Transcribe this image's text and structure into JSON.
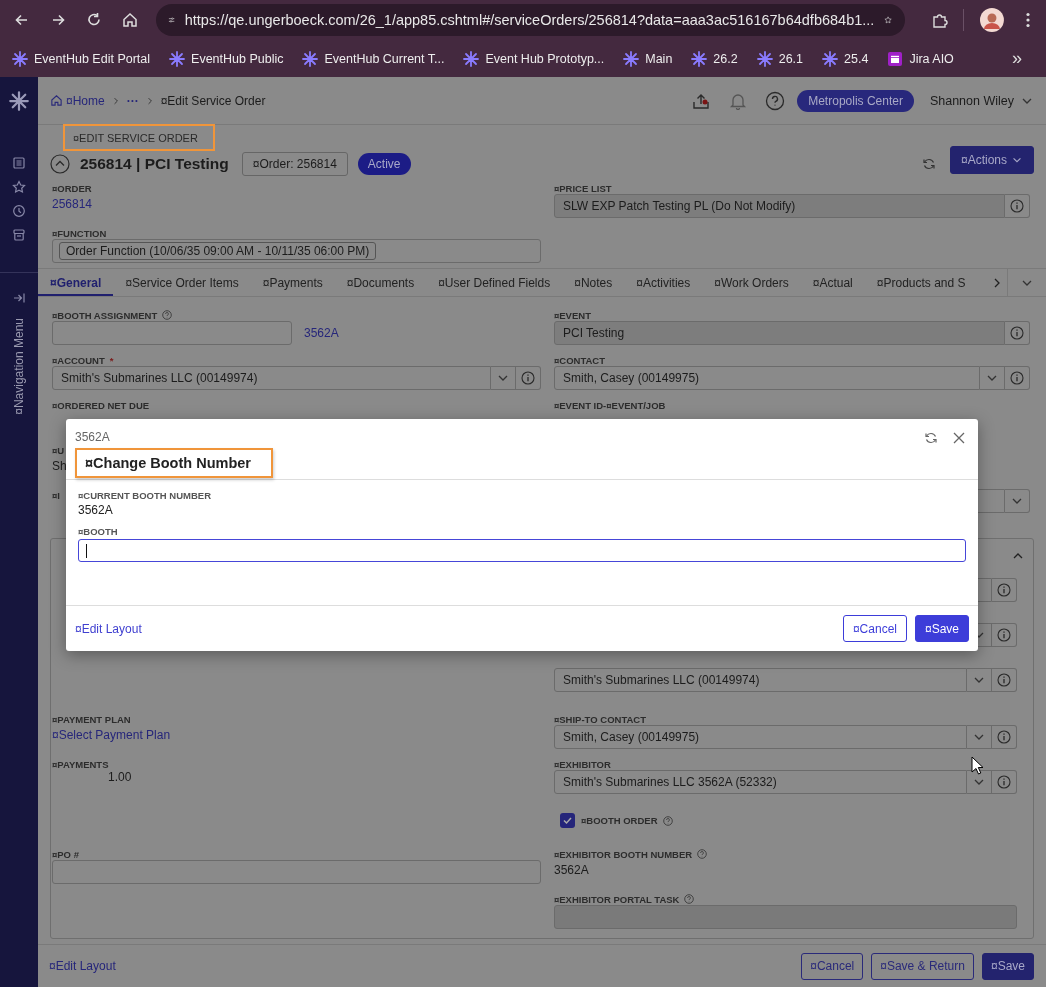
{
  "browser": {
    "url": "https://qe.ungerboeck.com/26_1/app85.cshtml#/serviceOrders/256814?data=aaa3ac516167b64dfb684b1...",
    "bookmarks": [
      {
        "label": "EventHub Edit Portal",
        "kind": "asterisk"
      },
      {
        "label": "EventHub Public",
        "kind": "asterisk"
      },
      {
        "label": "EventHub Current T...",
        "kind": "asterisk"
      },
      {
        "label": "Event Hub Prototyp...",
        "kind": "asterisk"
      },
      {
        "label": "Main",
        "kind": "asterisk"
      },
      {
        "label": "26.2",
        "kind": "asterisk"
      },
      {
        "label": "26.1",
        "kind": "asterisk"
      },
      {
        "label": "25.4",
        "kind": "asterisk"
      },
      {
        "label": "Jira AIO",
        "kind": "jira"
      }
    ],
    "overflow": "»"
  },
  "rail": {
    "nav_label": "¤Navigation Menu"
  },
  "header": {
    "breadcrumb": [
      {
        "label": "¤Home",
        "kind": "home"
      },
      {
        "label": "···",
        "kind": "ellipsis"
      },
      {
        "label": "¤Edit Service Order",
        "kind": "current"
      }
    ],
    "venue": "Metropolis Center",
    "user": "Shannon Wiley"
  },
  "page": {
    "eyebrow": "¤EDIT SERVICE ORDER",
    "title": "256814 | PCI Testing",
    "chip": "¤Order: 256814",
    "status": "Active",
    "actions": "¤Actions"
  },
  "top_rows": [
    [
      {
        "label": "¤ORDER",
        "kind": "link",
        "value": "256814"
      },
      {
        "label": "¤PRICE LIST",
        "kind": "readonly-info",
        "value": "SLW EXP Patch Testing PL (Do Not Modify)"
      }
    ],
    [
      {
        "label": "¤FUNCTION",
        "kind": "chip",
        "value": "Order Function (10/06/35 09:00 AM - 10/11/35 06:00 PM)"
      },
      null
    ]
  ],
  "tabs": [
    {
      "label": "¤General",
      "selected": true
    },
    {
      "label": "¤Service Order Items",
      "selected": false
    },
    {
      "label": "¤Payments",
      "selected": false
    },
    {
      "label": "¤Documents",
      "selected": false
    },
    {
      "label": "¤User Defined Fields",
      "selected": false
    },
    {
      "label": "¤Notes",
      "selected": false
    },
    {
      "label": "¤Activities",
      "selected": false
    },
    {
      "label": "¤Work Orders",
      "selected": false
    },
    {
      "label": "¤Actual",
      "selected": false
    },
    {
      "label": "¤Products and S",
      "selected": false
    }
  ],
  "general_rows": [
    [
      {
        "label": "¤BOOTH ASSIGNMENT",
        "help": true,
        "kind": "input-link",
        "value": "3562A"
      },
      {
        "label": "¤EVENT",
        "kind": "readonly-info",
        "value": "PCI Testing"
      }
    ],
    [
      {
        "label": "¤ACCOUNT",
        "required_mark": "*",
        "kind": "select-info",
        "value": "Smith's Submarines LLC (00149974)"
      },
      {
        "label": "¤CONTACT",
        "kind": "select-info",
        "value": "Smith, Casey (00149975)"
      }
    ],
    [
      {
        "label": "¤ORDERED NET DUE",
        "kind": "none"
      },
      {
        "label": "¤EVENT ID-¤EVENT/JOB",
        "kind": "none"
      }
    ],
    [
      {
        "label": "¤U",
        "kind": "text",
        "value": "Sh"
      },
      null
    ],
    [
      {
        "label": "¤I",
        "kind": "none"
      },
      {
        "kind": "select"
      }
    ]
  ],
  "panel_rows": [
    [
      null,
      {
        "kind": "input-info"
      }
    ],
    [
      null,
      {
        "kind": "select-info"
      }
    ],
    [
      null,
      {
        "kind": "select-info",
        "value": "Smith's Submarines LLC (00149974)"
      }
    ],
    [
      {
        "label": "¤PAYMENT PLAN",
        "kind": "link",
        "value": "¤Select Payment Plan"
      },
      {
        "label": "¤SHIP-TO CONTACT",
        "kind": "select-info",
        "value": "Smith, Casey (00149975)"
      }
    ],
    [
      {
        "label": "¤PAYMENTS",
        "kind": "amount",
        "value": "1.00"
      },
      {
        "label": "¤EXHIBITOR",
        "kind": "select-info",
        "value": "Smith's Submarines LLC 3562A (52332)"
      }
    ],
    [
      null,
      {
        "label": "¤BOOTH ORDER",
        "help": true,
        "kind": "checkbox",
        "checked": true
      }
    ],
    [
      {
        "label": "¤PO #",
        "kind": "input"
      },
      {
        "label": "¤EXHIBITOR BOOTH NUMBER",
        "help": true,
        "kind": "text",
        "value": "3562A"
      }
    ],
    [
      null,
      {
        "label": "¤EXHIBITOR PORTAL TASK",
        "help": true,
        "kind": "disabled"
      }
    ]
  ],
  "footer": {
    "link": "¤Edit Layout",
    "buttons": [
      {
        "label": "¤Cancel",
        "kind": "secondary"
      },
      {
        "label": "¤Save & Return",
        "kind": "secondary"
      },
      {
        "label": "¤Save",
        "kind": "primary"
      }
    ]
  },
  "dialog": {
    "subtitle": "3562A",
    "title": "¤Change Booth Number",
    "fields": [
      {
        "label": "¤CURRENT BOOTH NUMBER",
        "kind": "text",
        "value": "3562A"
      },
      {
        "label": "¤BOOTH",
        "kind": "input",
        "focused": true
      }
    ],
    "link": "¤Edit Layout",
    "buttons": [
      {
        "label": "¤Cancel",
        "kind": "secondary"
      },
      {
        "label": "¤Save",
        "kind": "primary"
      }
    ]
  }
}
